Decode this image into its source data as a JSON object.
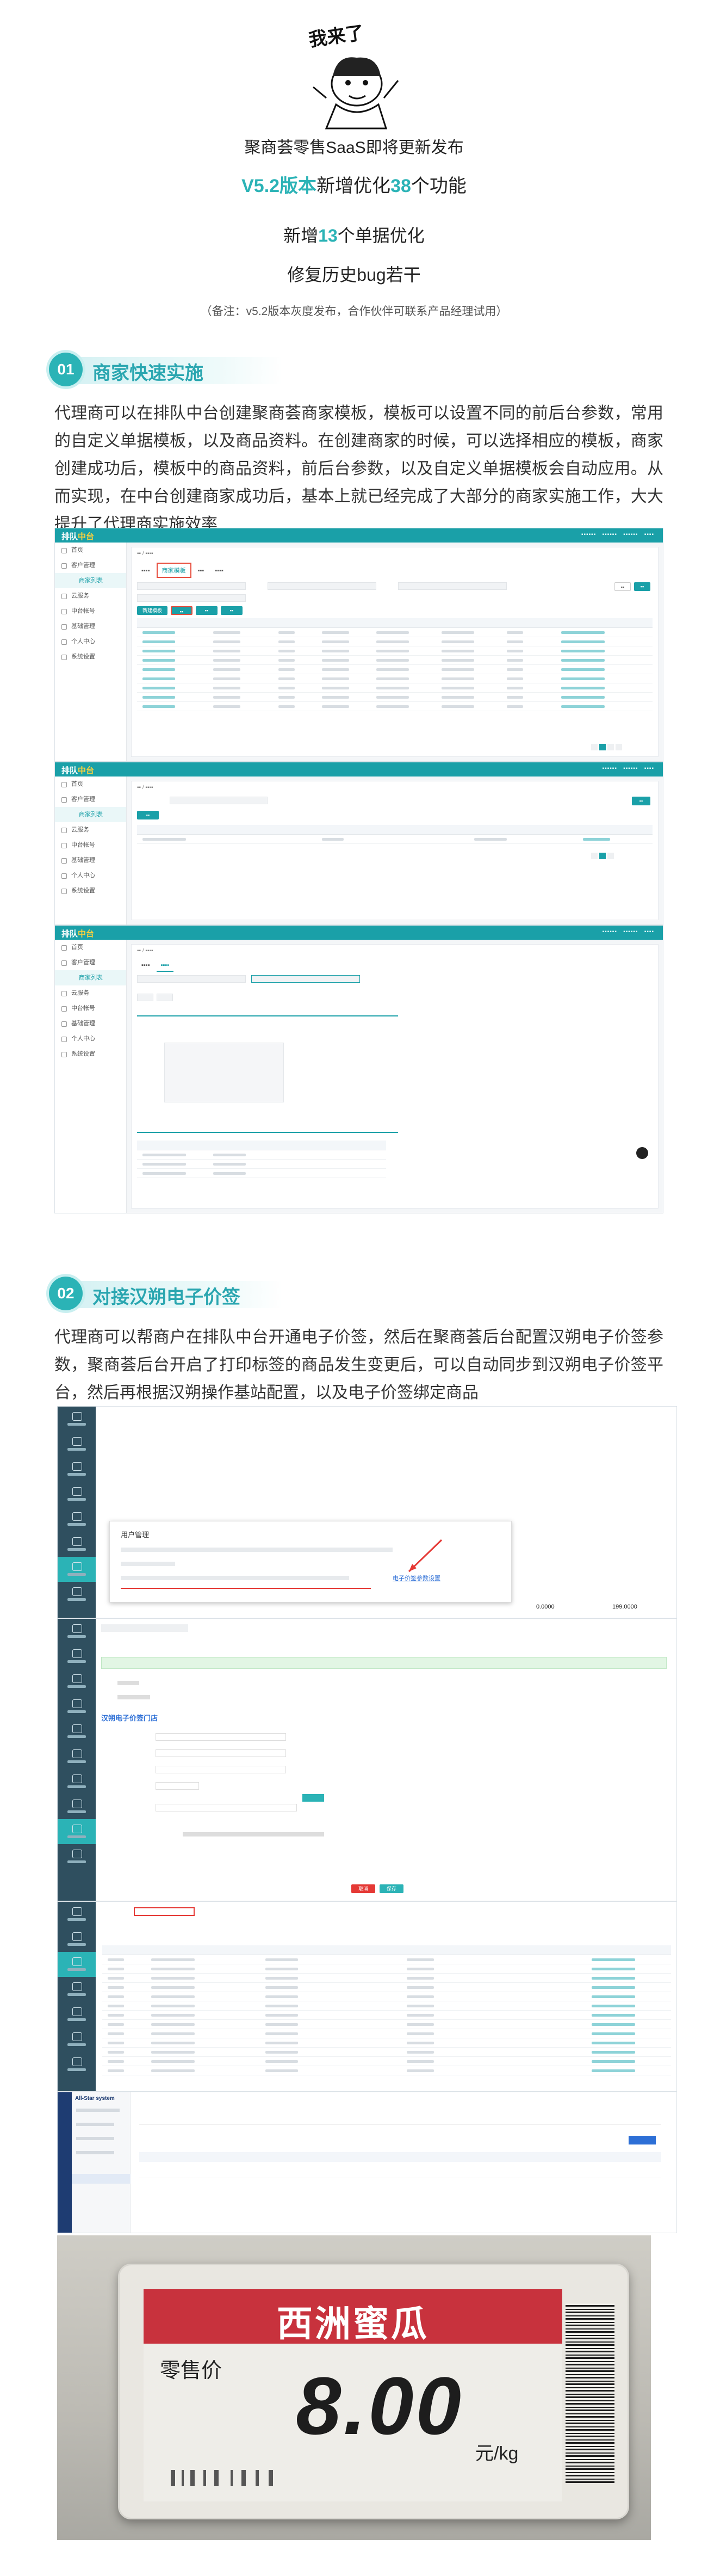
{
  "header": {
    "meme_text": "我来了",
    "line1": "聚商荟零售SaaS即将更新发布",
    "line2_version": "V5.2版本",
    "line2_mid": "新增优化",
    "line2_count": "38",
    "line2_tail": "个功能",
    "line3_pre": "新增",
    "line3_count": "13",
    "line3_tail": "个单据优化",
    "line4": "修复历史bug若干",
    "note": "（备注：v5.2版本灰度发布，合作伙伴可联系产品经理试用）"
  },
  "sections": [
    {
      "number": "01",
      "title": "商家快速实施",
      "body": "代理商可以在排队中台创建聚商荟商家模板，模板可以设置不同的前后台参数，常用的自定义单据模板，以及商品资料。在创建商家的时候，可以选择相应的模板，商家创建成功后，模板中的商品资料，前后台参数，以及自定义单据模板会自动应用。从而实现，在中台创建商家成功后，基本上就已经完成了大部分的商家实施工作，大大提升了代理商实施效率"
    },
    {
      "number": "02",
      "title": "对接汉朔电子价签",
      "body": "代理商可以帮商户在排队中台开通电子价签，然后在聚商荟后台配置汉朔电子价签参数，聚商荟后台开启了打印标签的商品发生变更后，可以自动同步到汉朔电子价签平台，然后再根据汉朔操作基站配置，以及电子价签绑定商品"
    }
  ],
  "screens": {
    "logo_main": "排队",
    "logo_accent": "中台",
    "menu": [
      "首页",
      "客户管理",
      "商家列表",
      "云服务",
      "中台帐号",
      "基础管理",
      "个人中心",
      "系统设置"
    ],
    "tab_active": "商家模板",
    "button_create": "新建模板",
    "panel2_title": "用户管理",
    "panel2_link": "电子价签参数设置",
    "panel2_value1": "0.0000",
    "panel2_value2": "199.0000",
    "panel3_title": "汉朔电子价签门店",
    "save_label": "保存",
    "cancel_label": "取消",
    "panel5_system": "All-Star system"
  },
  "price_tag": {
    "product_name": "西洲蜜瓜",
    "label": "零售价",
    "price": "8.00",
    "unit": "元/kg"
  },
  "colors": {
    "accent": "#2bb3b6",
    "topbar": "#1aa0a8",
    "tag_red": "#c8323d"
  }
}
